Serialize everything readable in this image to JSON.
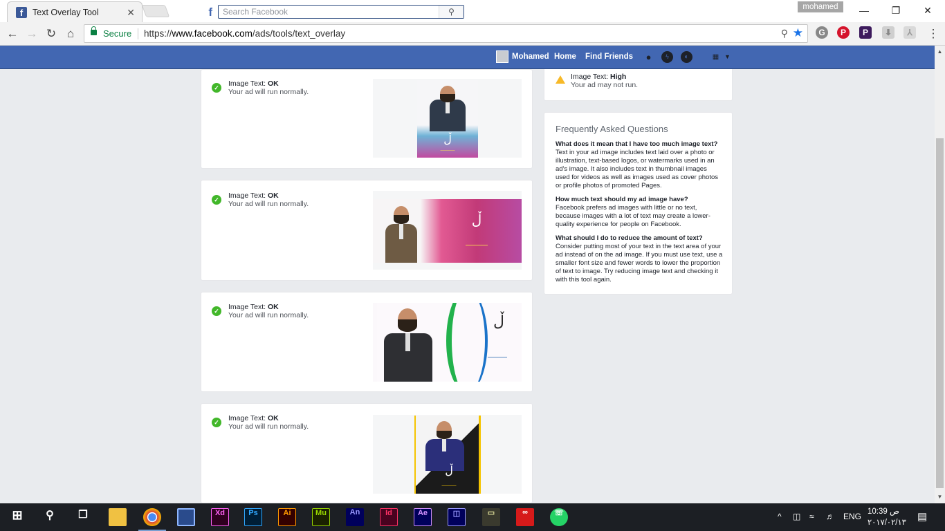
{
  "browser": {
    "tab_title": "Text Overlay Tool",
    "tab_close": "✕",
    "profile_name": "mohamed",
    "secure_label": "Secure",
    "url_scheme": "https://",
    "url_domain": "www.facebook.com",
    "url_path": "/ads/tools/text_overlay",
    "window_controls": [
      "—",
      "❐",
      "✕"
    ]
  },
  "facebook": {
    "search_placeholder": "Search Facebook",
    "user_name": "Mohamed",
    "nav_home": "Home",
    "nav_find_friends": "Find Friends",
    "brand_color": "#4267b2"
  },
  "results": [
    {
      "label": "Image Text: ",
      "rating": "OK",
      "message": "Your ad will run normally."
    },
    {
      "label": "Image Text: ",
      "rating": "OK",
      "message": "Your ad will run normally."
    },
    {
      "label": "Image Text: ",
      "rating": "OK",
      "message": "Your ad will run normally."
    },
    {
      "label": "Image Text: ",
      "rating": "OK",
      "message": "Your ad will run normally."
    }
  ],
  "high_result": {
    "label": "Image Text: ",
    "rating": "High",
    "message": "Your ad may not run."
  },
  "faq": {
    "title": "Frequently Asked Questions",
    "items": [
      {
        "q": "What does it mean that I have too much image text?",
        "a": "Text in your ad image includes text laid over a photo or illustration, text-based logos, or watermarks used in an ad's image. It also includes text in thumbnail images used for videos as well as images used as cover photos or profile photos of promoted Pages."
      },
      {
        "q": "How much text should my ad image have?",
        "a": "Facebook prefers ad images with little or no text, because images with a lot of text may create a lower-quality experience for people on Facebook."
      },
      {
        "q": "What should I do to reduce the amount of text?",
        "a": "Consider putting most of your text in the text area of your ad instead of on the ad image. If you must use text, use a smaller font size and fewer words to lower the proportion of text to image. Try reducing image text and checking it with this tool again."
      }
    ]
  },
  "taskbar": {
    "apps": [
      "File Explorer",
      "Chrome",
      "Brackets",
      "Xd",
      "Ps",
      "Ai",
      "Mu",
      "An",
      "Id",
      "Ae",
      "Pr",
      "Acrobat",
      "Creative Cloud",
      "WhatsApp"
    ],
    "language": "ENG",
    "time": "10:39 ص",
    "date": "٢٠١٧/٠٢/١٣"
  }
}
